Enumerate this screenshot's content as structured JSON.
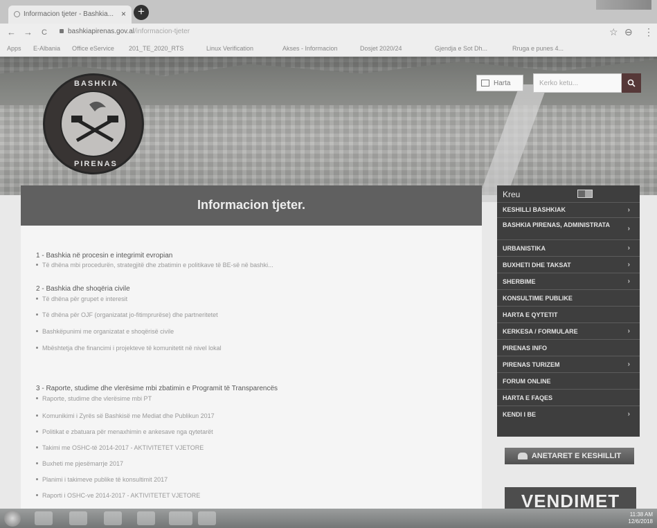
{
  "browser": {
    "tab_title": "Informacion tjeter - Bashkia...",
    "tab_close": "×",
    "new_tab": "+",
    "url_domain": "bashkiapirenas.gov.al",
    "url_path": "/informacion-tjeter",
    "back": "←",
    "forward": "→",
    "reload": "C",
    "star": "☆",
    "account": "⊖",
    "menu_dots": "⋮",
    "bookmarks": [
      "Apps",
      "E-Albania",
      "Office eService",
      "201_TE_2020_RTS",
      "Linux Verification",
      "Akses - Informacion",
      "Dosjet 2020/24",
      "Gjendja e Sot Dh...",
      "Rruga e punes 4..."
    ]
  },
  "header": {
    "logo_text_top": "BASHKIA",
    "logo_text_bottom": "PIRENAS",
    "lang_label": "Harta",
    "search_placeholder": "Kerko ketu...",
    "search_icon": "search-icon",
    "search_glyph": "🔍"
  },
  "banner": {
    "title": "Informacion tjeter."
  },
  "content": {
    "sections": [
      {
        "title": "1 - Bashkia në procesin e integrimit evropian",
        "items": [
          "Të dhëna mbi procedurën, strategjitë dhe zbatimin e politikave të BE-së në bashki..."
        ]
      },
      {
        "title": "2 - Bashkia dhe shoqëria civile",
        "items": [
          "Të dhëna për grupet e interesit",
          "Të dhëna për OJF (organizatat jo-fitimprurëse) dhe partneritetet",
          "Bashkëpunimi me organizatat e shoqërisë civile",
          "Mbështetja dhe financimi i projekteve të komunitetit në nivel lokal"
        ]
      },
      {
        "title": "3 - Raporte, studime dhe vlerësime mbi zbatimin e Programit të Transparencës",
        "items": [
          "Raporte, studime dhe vlerësime mbi PT",
          "Komunikimi i Zyrës së Bashkisë me Mediat dhe Publikun 2017",
          "Politikat e zbatuara për menaxhimin e ankesave nga qytetarët",
          "Takimi me OSHC-të 2014-2017 - AKTIVITETET VJETORE",
          "Buxheti me pjesëmarrje 2017",
          "Planimi i takimeve publike të konsultimit 2017",
          "Raporti i OSHC-ve 2014-2017 - AKTIVITETET VJETORE"
        ]
      }
    ]
  },
  "menu": {
    "title": "Kreu",
    "items": [
      {
        "label": "KESHILLI BASHKIAK",
        "chev": "›"
      },
      {
        "label": "BASHKIA PIRENAS, ADMINISTRATA",
        "chev": "›"
      },
      {
        "label": "URBANISTIKA",
        "chev": "›"
      },
      {
        "label": "BUXHETI DHE TAKSAT",
        "chev": "›"
      },
      {
        "label": "SHERBIME",
        "chev": "›"
      },
      {
        "label": "KONSULTIME PUBLIKE",
        "chev": ""
      },
      {
        "label": "HARTA E QYTETIT",
        "chev": ""
      },
      {
        "label": "KERKESA / FORMULARE",
        "chev": "›"
      },
      {
        "label": "PIRENAS INFO",
        "chev": ""
      },
      {
        "label": "PIRENAS TURIZEM",
        "chev": "›"
      },
      {
        "label": "FORUM ONLINE",
        "chev": ""
      },
      {
        "label": "HARTA E FAQES",
        "chev": ""
      },
      {
        "label": "KENDI I BE",
        "chev": "›"
      }
    ]
  },
  "side": {
    "council_button": "ANETARET E KESHILLIT",
    "decisions_banner": "VENDIMET"
  },
  "taskbar": {
    "time": "11:38 AM",
    "date": "12/6/2018"
  }
}
